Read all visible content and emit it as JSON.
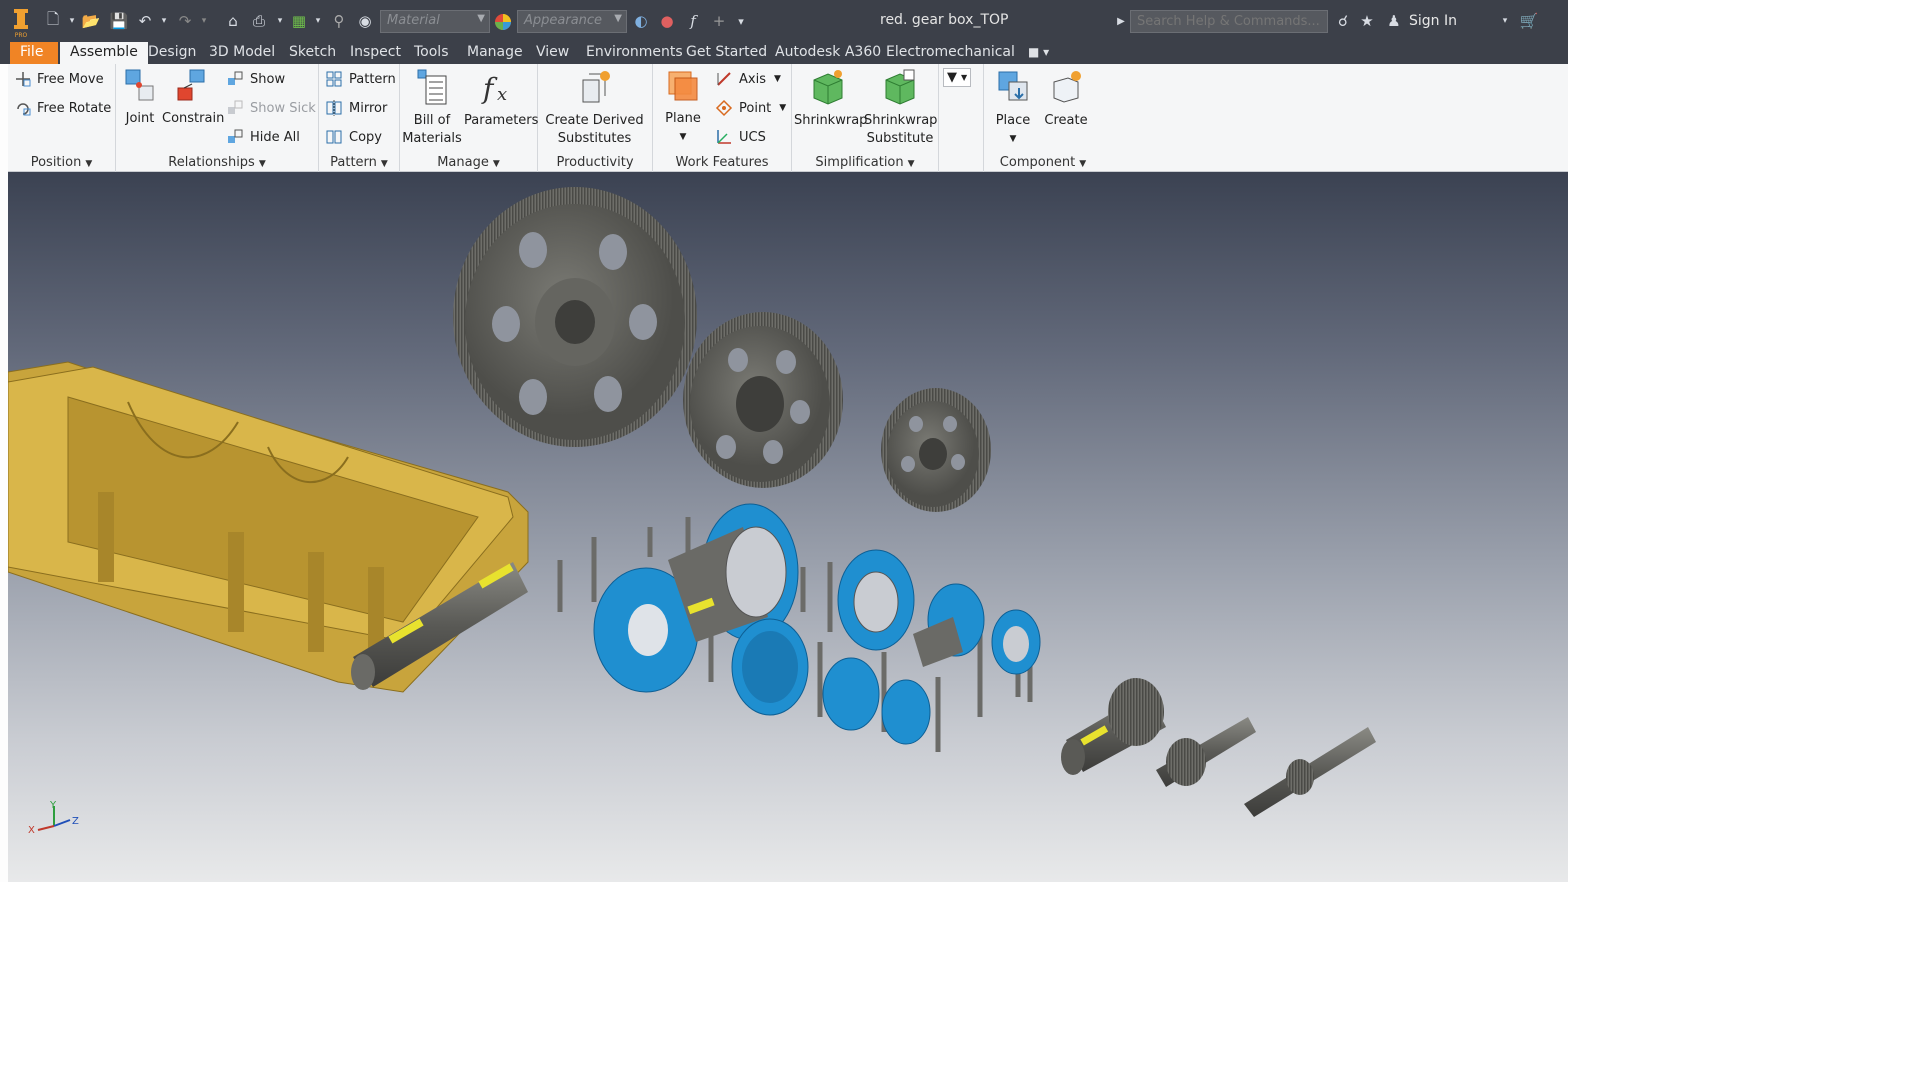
{
  "app": {
    "name": "Autodesk Inventor Professional",
    "logo_letters": "I PRO"
  },
  "title_bar": {
    "document_title": "red. gear box_TOP",
    "material_placeholder": "Material",
    "appearance_placeholder": "Appearance",
    "search_placeholder": "Search Help & Commands...",
    "sign_in_label": "Sign In"
  },
  "tabs": [
    {
      "label": "File"
    },
    {
      "label": "Assemble"
    },
    {
      "label": "Design"
    },
    {
      "label": "3D Model"
    },
    {
      "label": "Sketch"
    },
    {
      "label": "Inspect"
    },
    {
      "label": "Tools"
    },
    {
      "label": "Manage"
    },
    {
      "label": "View"
    },
    {
      "label": "Environments"
    },
    {
      "label": "Get Started"
    },
    {
      "label": "Autodesk A360"
    },
    {
      "label": "Electromechanical"
    }
  ],
  "ribbon": {
    "position": {
      "title": "Position",
      "free_move": "Free Move",
      "free_rotate": "Free Rotate"
    },
    "relationships": {
      "title": "Relationships",
      "joint": "Joint",
      "constrain": "Constrain",
      "show": "Show",
      "show_sick": "Show Sick",
      "hide_all": "Hide All"
    },
    "pattern": {
      "title": "Pattern",
      "pattern": "Pattern",
      "mirror": "Mirror",
      "copy": "Copy"
    },
    "manage": {
      "title": "Manage",
      "bom_1": "Bill of",
      "bom_2": "Materials",
      "parameters": "Parameters"
    },
    "productivity": {
      "title": "Productivity",
      "cds_1": "Create Derived",
      "cds_2": "Substitutes"
    },
    "work_features": {
      "title": "Work Features",
      "plane": "Plane",
      "axis": "Axis",
      "point": "Point",
      "ucs": "UCS"
    },
    "simplification": {
      "title": "Simplification",
      "shrinkwrap": "Shrinkwrap",
      "sws_1": "Shrinkwrap",
      "sws_2": "Substitute"
    },
    "component": {
      "title": "Component",
      "place": "Place",
      "create": "Create"
    }
  },
  "viewport": {
    "triad_labels": {
      "x": "X",
      "y": "Y",
      "z": "Z"
    }
  },
  "colors": {
    "housing": "#c8a43c",
    "gear": "#5c5c58",
    "bearing_blue": "#1f8fd0",
    "file_tab": "#f08425"
  }
}
